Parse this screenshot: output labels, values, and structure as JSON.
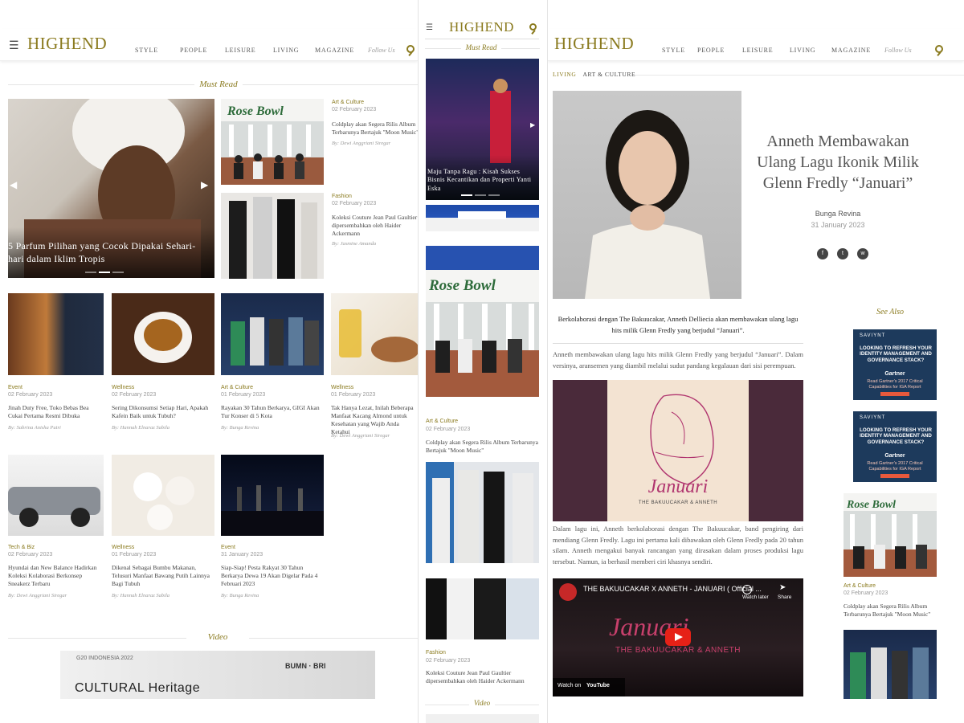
{
  "site": {
    "logo": "HIGHEND",
    "nav": [
      "STYLE",
      "PEOPLE",
      "LEISURE",
      "LIVING",
      "MAGAZINE"
    ],
    "follow": "Follow Us"
  },
  "home": {
    "must_read": "Must Read",
    "hero_caption": "5 Parfum Pilihan yang Cocok Dipakai Sehari-hari dalam Iklim Tropis",
    "side": [
      {
        "category": "Art & Culture",
        "date": "02 February 2023",
        "title": "Coldplay akan Segera Rilis Album Terbarunya Bertajuk \"Moon Music\"",
        "author": "By: Dewi Anggriani Siregar"
      },
      {
        "category": "Fashion",
        "date": "02 February 2023",
        "title": "Koleksi Couture Jean Paul Gaultier dipersembahkan oleh Haider Ackermann",
        "author": "By: Jasmine Amanda"
      }
    ],
    "row1": [
      {
        "category": "Event",
        "date": "02 February 2023",
        "title": "Jinah Duty Free, Toko Bebas Bea Cukai Pertama Resmi Dibuka",
        "author": "By: Sabrina Anisha Putri"
      },
      {
        "category": "Wellness",
        "date": "02 February 2023",
        "title": "Sering Dikonsumsi Setiap Hari, Apakah Kafein Baik untuk Tubuh?",
        "author": "By: Hannah Elnaraz Sabila"
      },
      {
        "category": "Art & Culture",
        "date": "01 February 2023",
        "title": "Rayakan 30 Tahun Berkarya, GIGI Akan Tur Konser di 5 Kota",
        "author": "By: Bunga Revina"
      },
      {
        "category": "Wellness",
        "date": "01 February 2023",
        "title": "Tak Hanya Lezat, Inilah Beberapa Manfaat Kacang Almond untuk Kesehatan yang Wajib Anda Ketahui",
        "author": "By: Dewi Anggriani Siregar"
      }
    ],
    "row2": [
      {
        "category": "Tech & Biz",
        "date": "02 February 2023",
        "title": "Hyundai dan New Balance Hadirkan Koleksi Kolaborasi Berkonsep Sneakerz Terbaru",
        "author": "By: Dewi Anggriani Siregar"
      },
      {
        "category": "Wellness",
        "date": "01 February 2023",
        "title": "Dikenal Sebagai Bumbu Makanan, Telusuri Manfaat Bawang Putih Lainnya Bagi Tubuh",
        "author": "By: Hannah Elnaraz Sabila"
      },
      {
        "category": "Event",
        "date": "31 January 2023",
        "title": "Siap-Siap! Pesta Rakyat 30 Tahun Berkarya Dewa 19 Akan Digelar Pada 4 Februari 2023",
        "author": "By: Bunga Revina"
      }
    ],
    "video": "Video",
    "video_banner": "CULTURAL Heritage",
    "video_g20": "G20 INDONESIA 2022",
    "video_sponsor": "BUMN · BRI"
  },
  "mobile": {
    "must_read": "Must Read",
    "hero_caption": "Maju Tanpa Ragu : Kisah Sukses Bisnis Kecantikan dan Properti Yanti Eska",
    "card1": {
      "category": "Art & Culture",
      "date": "02 February 2023",
      "title": "Coldplay akan Segera Rilis Album Terbarunya Bertajuk \"Moon Music\""
    },
    "card2": {
      "category": "Fashion",
      "date": "02 February 2023",
      "title": "Koleksi Couture Jean Paul Gaultier dipersembahkan oleh Haider Ackermann"
    },
    "video": "Video"
  },
  "article": {
    "crumbs": [
      "LIVING",
      "ART & CULTURE"
    ],
    "title": "Anneth Membawakan Ulang Lagu Ikonik Milik Glenn Fredly “Januari”",
    "author": "Bunga Revina",
    "date": "31 January 2023",
    "share": [
      "f",
      "t",
      "w"
    ],
    "lead": "Berkolaborasi dengan The Bakuucakar, Anneth Delliecia akan membawakan ulang lagu hits milik Glenn Fredly yang berjudul “Januari”.",
    "p1": "Anneth membawakan ulang lagu hits milik Glenn Fredly yang berjudul “Januari”. Dalam versinya, aransemen yang diambil melalui sudut pandang kegalauan dari sisi perempuan.",
    "p2": "Dalam lagu ini, Anneth berkolaborasi dengan The Bakuucakar, band pengiring dari mendiang Glenn Fredly. Lagu ini pertama kali dibawakan oleh Glenn Fredly pada 20 tahun silam. Anneth mengakui banyak rancangan yang dirasakan dalam proses produksi lagu tersebut. Namun, ia berhasil memberi ciri khasnya sendiri.",
    "cover_script": "Januari",
    "cover_sub": "THE BAKUUCAKAR & ANNETH",
    "video_title": "THE BAKUUCAKAR X ANNETH - JANUARI ( Official ...",
    "video_script": "Januari",
    "video_sub": "THE BAKUUCAKAR & ANNETH",
    "watch_later": "Watch later",
    "share_label": "Share",
    "watch_on": "Watch on",
    "youtube": "YouTube",
    "see_also": "See Also",
    "ad": {
      "brand": "SAVIYNT",
      "headline": "LOOKING TO REFRESH YOUR IDENTITY MANAGEMENT AND GOVERNANCE STACK?",
      "gartner": "Gartner",
      "sub": "Read Gartner's 2017 Critical Capabilities for IGA Report"
    },
    "related": {
      "category": "Art & Culture",
      "date": "02 February 2023",
      "title": "Coldplay akan Segera Rilis Album Terbarunya Bertajuk \"Moon Music\""
    }
  }
}
